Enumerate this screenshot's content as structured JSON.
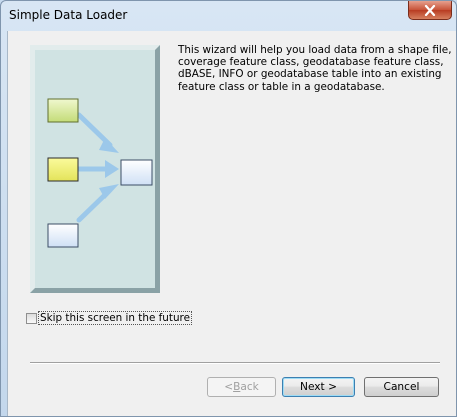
{
  "window": {
    "title": "Simple Data Loader",
    "close_icon": "close-icon"
  },
  "wizard": {
    "intro_text": "This wizard will help you load data from a shape file, coverage feature class, geodatabase feature class, dBASE, INFO or geodatabase table into an existing feature class or table in a geodatabase.",
    "skip_label": "Skip this screen in the future",
    "skip_checked": false
  },
  "buttons": {
    "back_prefix": "< ",
    "back_hotkey": "B",
    "back_rest": "ack",
    "next_label": "Next >",
    "cancel_label": "Cancel"
  },
  "illustration": {
    "icons": [
      "source-box-icon",
      "source-box-icon",
      "source-box-icon",
      "target-box-icon",
      "arrow-icon"
    ],
    "colors": {
      "panel_bg": "#d0e3e3",
      "source_green": "#d9ec9c",
      "source_yellow": "#f2f27a",
      "source_blue": "#e9f1fb",
      "target_blue": "#e9f1fb",
      "arrow": "#9cc8ea"
    }
  }
}
